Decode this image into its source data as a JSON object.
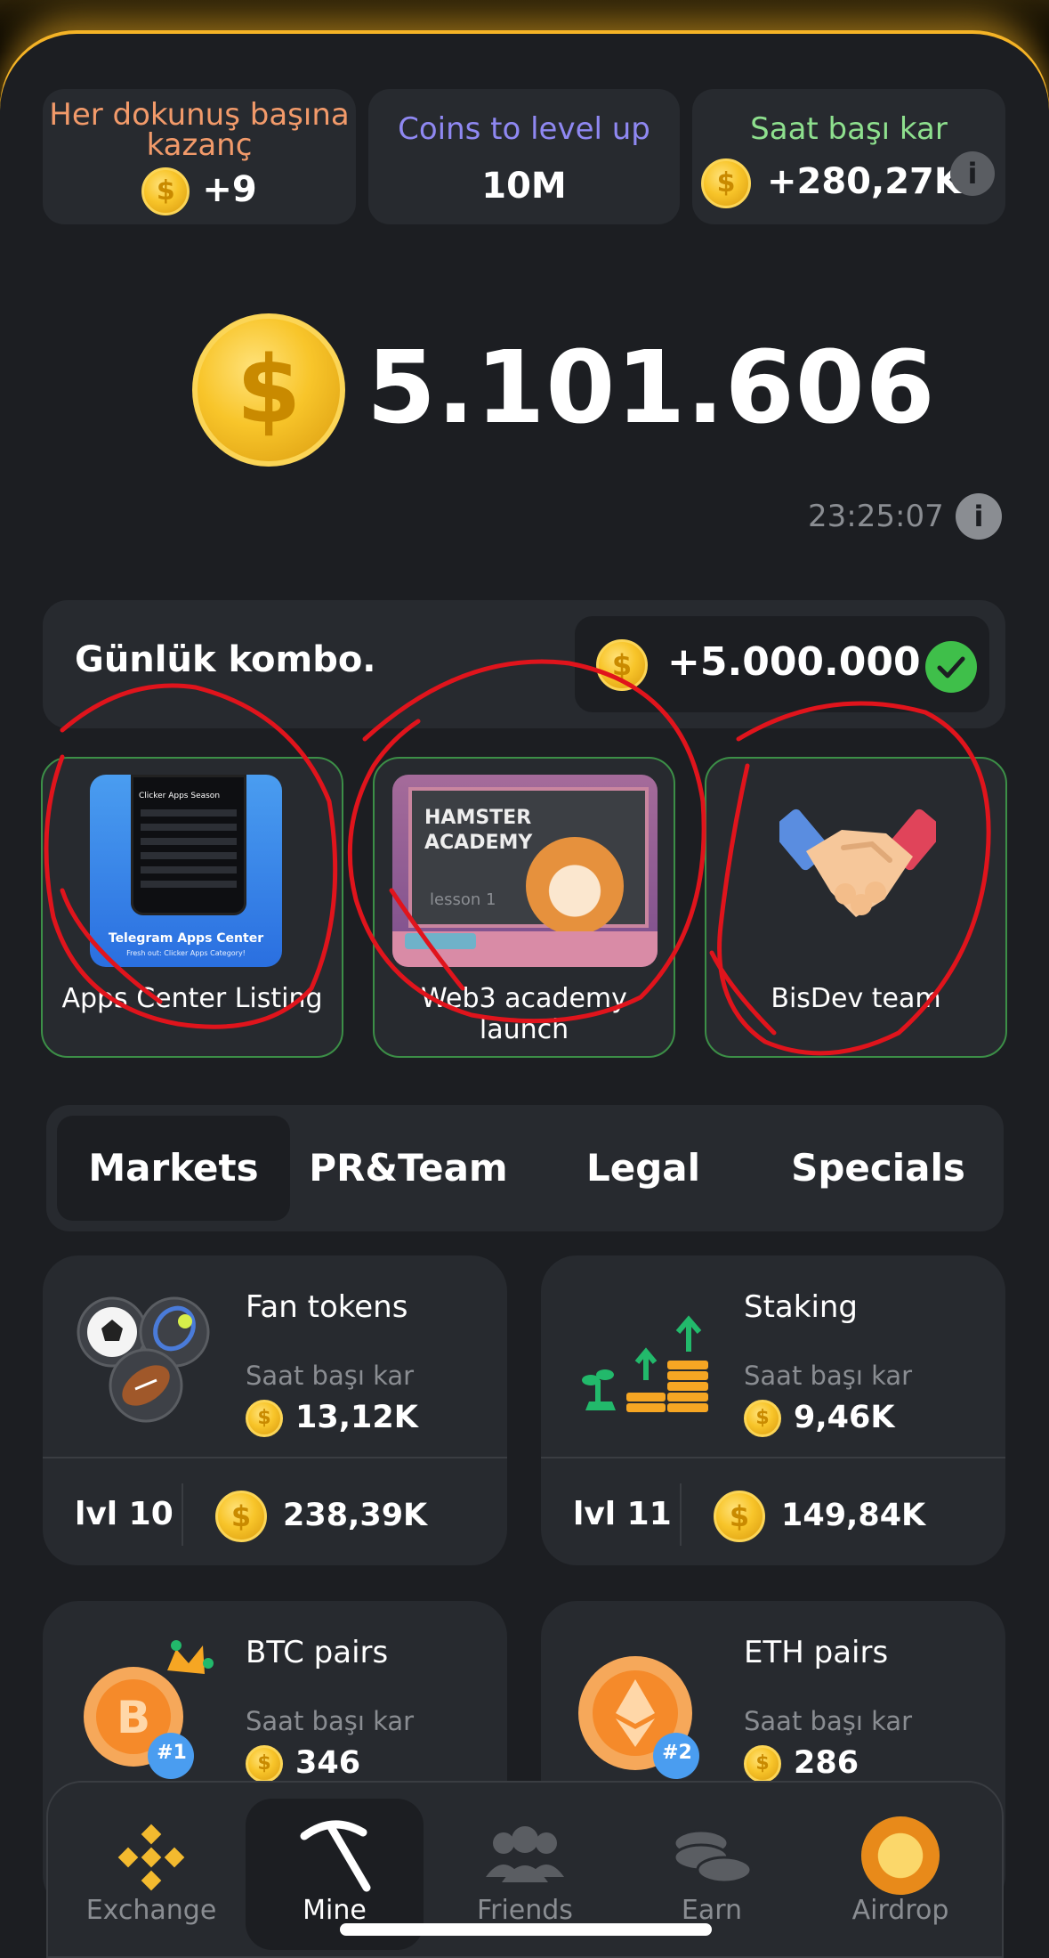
{
  "stats": [
    {
      "label": "Her dokunuş başına kazanç",
      "value": "+9",
      "label_color": "#f29a6a"
    },
    {
      "label": "Coins to level up",
      "value": "10M",
      "label_color": "#8f88f2"
    },
    {
      "label": "Saat başı kar",
      "value": "+280,27K",
      "label_color": "#8ee08e"
    }
  ],
  "balance": "5.101.606",
  "timer": "23:25:07",
  "info_glyph": "i",
  "coin_glyph": "$",
  "combo": {
    "title": "Günlük kombo.",
    "reward": "+5.000.000"
  },
  "combo_cards": [
    {
      "caption": "Apps Center Listing",
      "icon": "telegram-apps-center-image"
    },
    {
      "caption": "Web3 academy launch",
      "icon": "hamster-academy-image"
    },
    {
      "caption": "BisDev team",
      "icon": "handshake-icon"
    }
  ],
  "apps_center_thumb": {
    "line1": "Telegram Apps Center",
    "line2": "Fresh out: Clicker Apps Category!",
    "screen_title": "Clicker Apps Season"
  },
  "academy_thumb": {
    "line1": "HAMSTER",
    "line2": "ACADEMY",
    "line3": "lesson 1"
  },
  "tabs": [
    "Markets",
    "PR&Team",
    "Legal",
    "Specials"
  ],
  "active_tab": "Markets",
  "market_cards": [
    {
      "title": "Fan tokens",
      "sub": "Saat başı kar",
      "profit": "13,12K",
      "level": "lvl 10",
      "price": "238,39K"
    },
    {
      "title": "Staking",
      "sub": "Saat başı kar",
      "profit": "9,46K",
      "level": "lvl 11",
      "price": "149,84K"
    },
    {
      "title": "BTC pairs",
      "sub": "Saat başı kar",
      "profit": "346",
      "badge": "#1"
    },
    {
      "title": "ETH pairs",
      "sub": "Saat başı kar",
      "profit": "286",
      "badge": "#2"
    }
  ],
  "nav": [
    {
      "label": "Exchange",
      "icon": "binance-icon"
    },
    {
      "label": "Mine",
      "icon": "pickaxe-icon"
    },
    {
      "label": "Friends",
      "icon": "friends-icon"
    },
    {
      "label": "Earn",
      "icon": "coins-icon"
    },
    {
      "label": "Airdrop",
      "icon": "hamster-coin-icon"
    }
  ],
  "colors": {
    "background": "#1c1e22",
    "card": "#272a2f",
    "accent_gold": "#f4b326",
    "green_check": "#3fbf4a",
    "annotation_red": "#e0141c"
  }
}
